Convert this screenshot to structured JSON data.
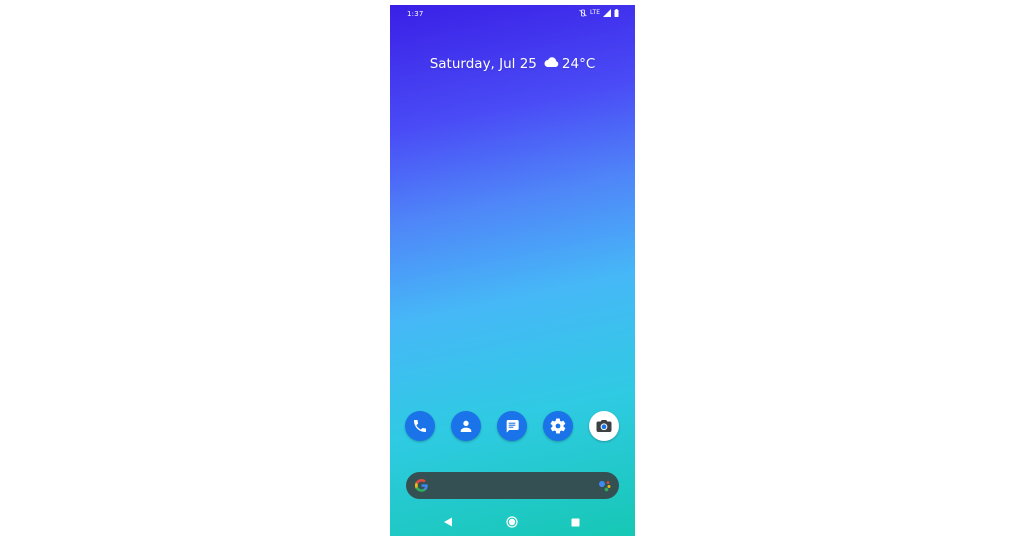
{
  "status_bar": {
    "time": "1:37",
    "network_label": "LTE",
    "icons": [
      "vibrate-off-icon",
      "lte-icon",
      "signal-icon",
      "battery-icon"
    ]
  },
  "glance": {
    "date": "Saturday, Jul 25",
    "weather_icon": "cloud-icon",
    "temperature": "24°C"
  },
  "dock": {
    "apps": [
      {
        "icon": "phone-icon",
        "bg": "#1a73e8"
      },
      {
        "icon": "contacts-icon",
        "bg": "#1a73e8"
      },
      {
        "icon": "messages-icon",
        "bg": "#1a73e8"
      },
      {
        "icon": "settings-icon",
        "bg": "#1a73e8"
      },
      {
        "icon": "camera-icon",
        "bg": "#ffffff"
      }
    ]
  },
  "search": {
    "logo": "google-g-icon",
    "assistant": "assistant-icon",
    "bg": "#37474a"
  },
  "nav": {
    "buttons": [
      "back-icon",
      "home-icon",
      "recents-icon"
    ]
  }
}
